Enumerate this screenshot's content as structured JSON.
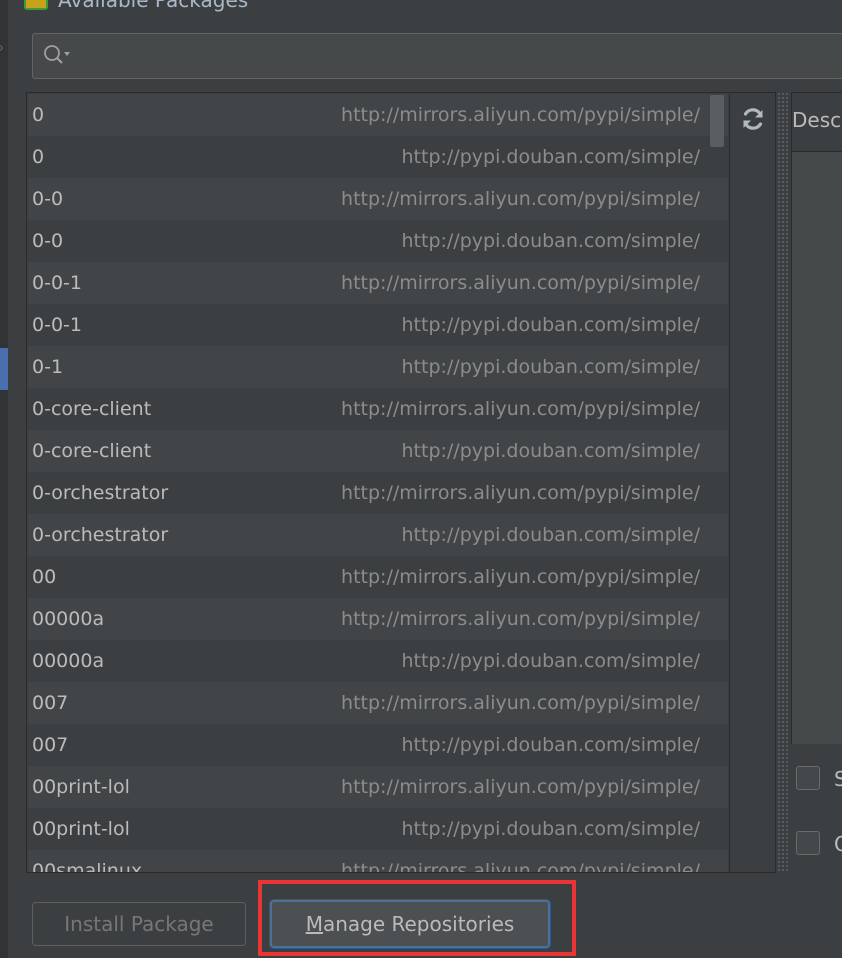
{
  "window": {
    "title": "Available Packages"
  },
  "search": {
    "value": "",
    "placeholder": ""
  },
  "packages": [
    {
      "name": "0",
      "repo": "http://mirrors.aliyun.com/pypi/simple/"
    },
    {
      "name": "0",
      "repo": "http://pypi.douban.com/simple/"
    },
    {
      "name": "0-0",
      "repo": "http://mirrors.aliyun.com/pypi/simple/"
    },
    {
      "name": "0-0",
      "repo": "http://pypi.douban.com/simple/"
    },
    {
      "name": "0-0-1",
      "repo": "http://mirrors.aliyun.com/pypi/simple/"
    },
    {
      "name": "0-0-1",
      "repo": "http://pypi.douban.com/simple/"
    },
    {
      "name": "0-1",
      "repo": "http://pypi.douban.com/simple/"
    },
    {
      "name": "0-core-client",
      "repo": "http://mirrors.aliyun.com/pypi/simple/"
    },
    {
      "name": "0-core-client",
      "repo": "http://pypi.douban.com/simple/"
    },
    {
      "name": "0-orchestrator",
      "repo": "http://mirrors.aliyun.com/pypi/simple/"
    },
    {
      "name": "0-orchestrator",
      "repo": "http://pypi.douban.com/simple/"
    },
    {
      "name": "00",
      "repo": "http://mirrors.aliyun.com/pypi/simple/"
    },
    {
      "name": "00000a",
      "repo": "http://mirrors.aliyun.com/pypi/simple/"
    },
    {
      "name": "00000a",
      "repo": "http://pypi.douban.com/simple/"
    },
    {
      "name": "007",
      "repo": "http://mirrors.aliyun.com/pypi/simple/"
    },
    {
      "name": "007",
      "repo": "http://pypi.douban.com/simple/"
    },
    {
      "name": "00print-lol",
      "repo": "http://mirrors.aliyun.com/pypi/simple/"
    },
    {
      "name": "00print-lol",
      "repo": "http://pypi.douban.com/simple/"
    },
    {
      "name": "00smalinux",
      "repo": "http://mirrors.aliyun.com/pypi/simple/"
    }
  ],
  "description": {
    "label": "Desc"
  },
  "options": [
    {
      "label": "S",
      "checked": false
    },
    {
      "label": "O",
      "checked": false
    }
  ],
  "buttons": {
    "install_label": "Install Package",
    "manage_mnemonic": "M",
    "manage_rest": "anage Repositories"
  },
  "icons": {
    "search": "search-icon",
    "reload": "reload-icon"
  },
  "colors": {
    "background": "#3c3f41",
    "row_alt": "#414547",
    "package_text": "#bbbbbb",
    "repo_text": "#8c8c8c",
    "focus_border": "#4d7099",
    "highlight_annotation": "#ea3535"
  }
}
